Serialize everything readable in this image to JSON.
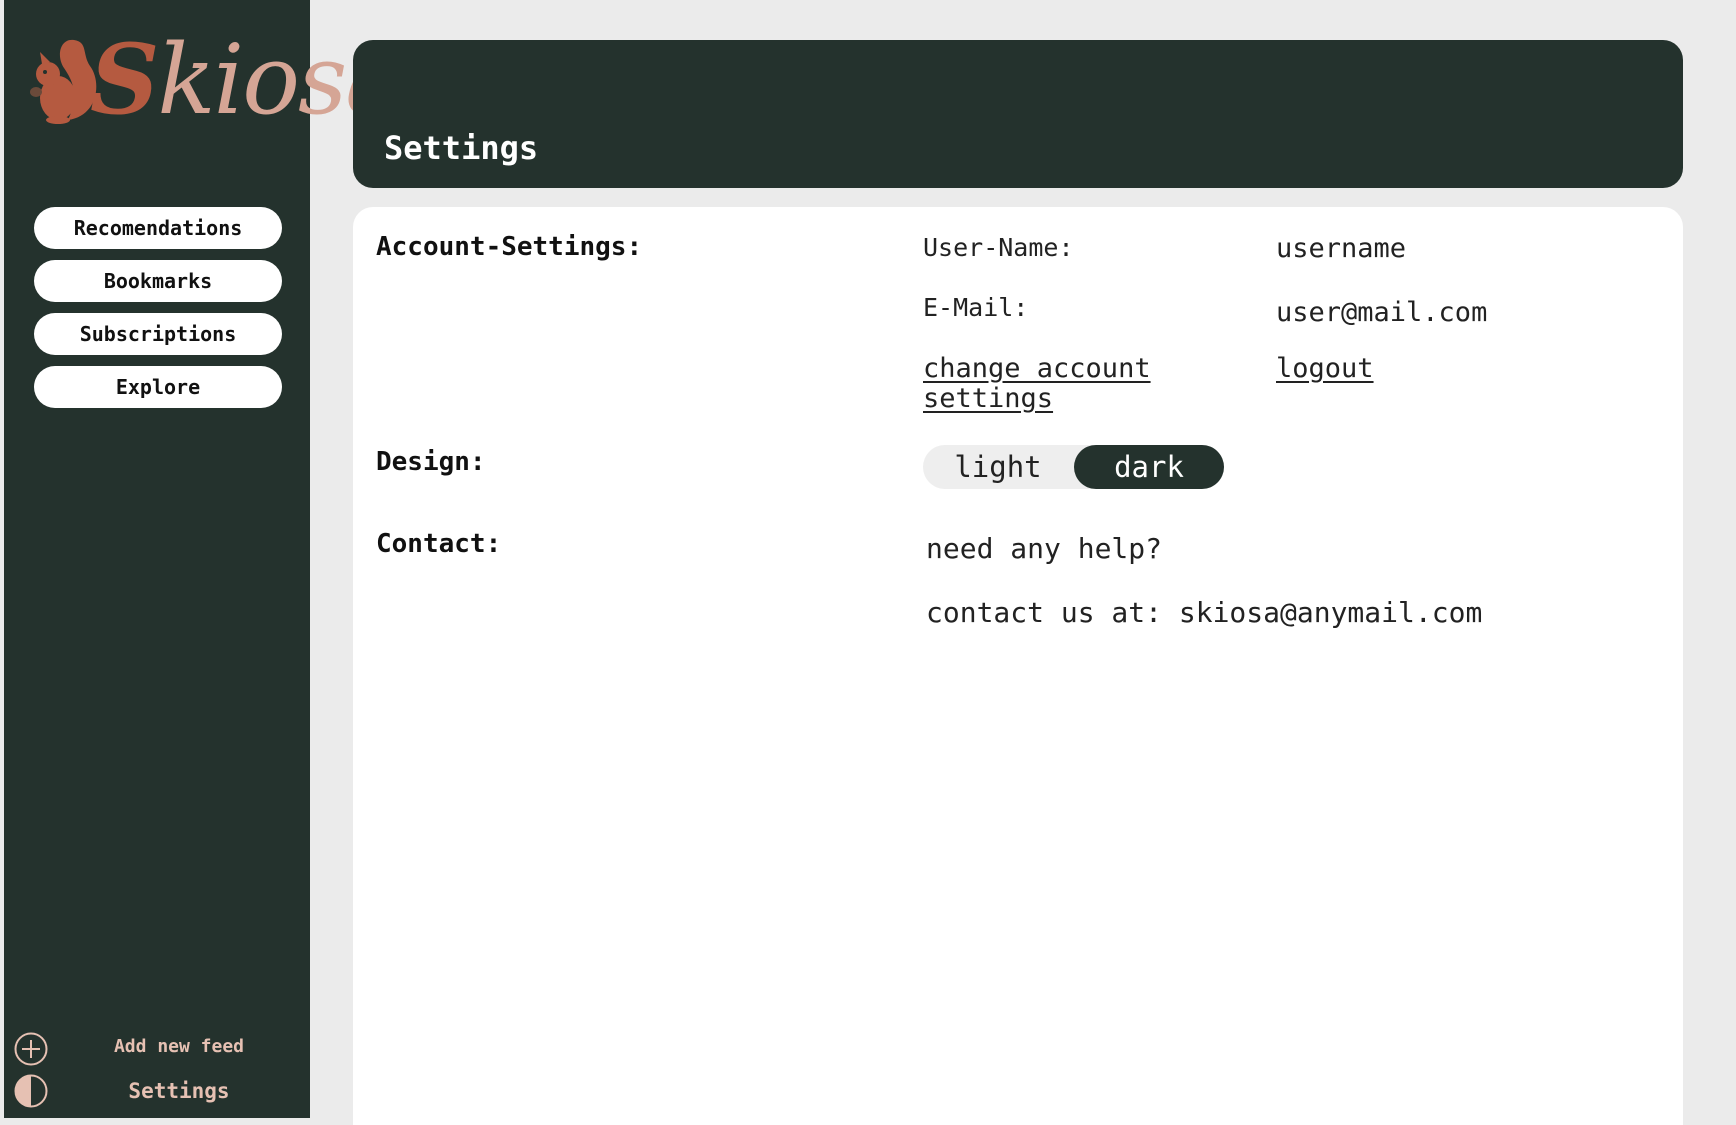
{
  "brand": {
    "logo_text": "Skiosa",
    "logo_first": "S",
    "logo_rest": "kiosa"
  },
  "nav": {
    "items": [
      {
        "label": "Recomendations"
      },
      {
        "label": "Bookmarks"
      },
      {
        "label": "Subscriptions"
      },
      {
        "label": "Explore"
      }
    ]
  },
  "sidebar_footer": {
    "add_feed_label": "Add new feed",
    "add_feed_icon": "plus-circle-icon",
    "settings_label": "Settings",
    "settings_icon": "contrast-icon"
  },
  "header": {
    "title": "Settings"
  },
  "account": {
    "section_title": "Account-Settings:",
    "username_label": "User-Name:",
    "username_value": "username",
    "email_label": "E-Mail:",
    "email_value": "user@mail.com",
    "change_link": "change account settings",
    "logout_link": "logout"
  },
  "design": {
    "section_title": "Design:",
    "option_light": "light",
    "option_dark": "dark",
    "selected": "dark"
  },
  "contact": {
    "section_title": "Contact:",
    "help_text": "need any help?",
    "contact_text": "contact us at: skiosa@anymail.com"
  },
  "colors": {
    "sidebar_bg": "#24322d",
    "page_bg": "#ebebeb",
    "accent_text": "#e6c1b3",
    "logo_brown": "#b55a40",
    "logo_pink": "#d5a595"
  }
}
